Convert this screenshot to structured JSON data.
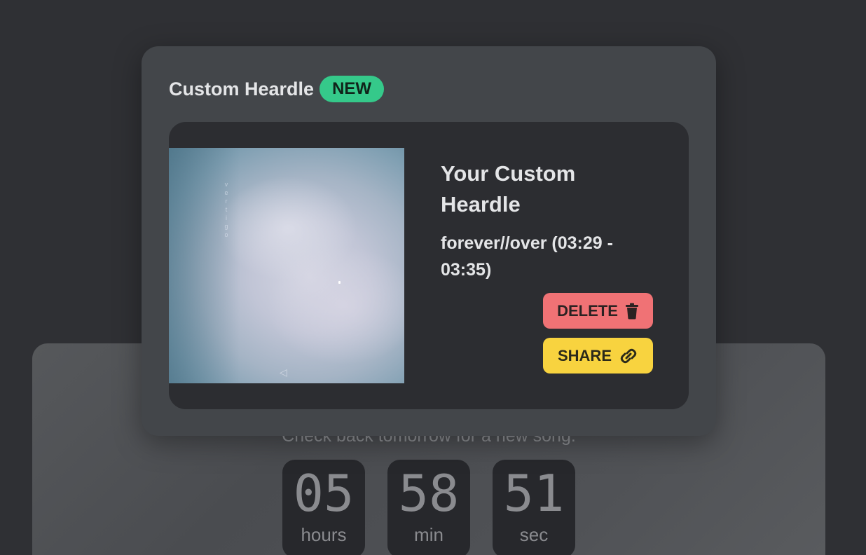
{
  "background": {
    "message": "Check back tomorrow for a new song.",
    "countdown": [
      {
        "value": "05",
        "unit": "hours"
      },
      {
        "value": "58",
        "unit": "min"
      },
      {
        "value": "51",
        "unit": "sec"
      }
    ]
  },
  "panel": {
    "title": "Custom Heardle",
    "badge": "NEW",
    "card": {
      "heading": "Your Custom Heardle",
      "song": "forever//over (03:29 - 03:35)",
      "cover_text": "vertigo",
      "delete_label": "DELETE",
      "share_label": "SHARE"
    }
  },
  "icons": {
    "delete": "trash-icon",
    "share": "link-icon"
  },
  "colors": {
    "badge": "#35c98a",
    "delete": "#f07275",
    "share": "#f8d33f"
  }
}
